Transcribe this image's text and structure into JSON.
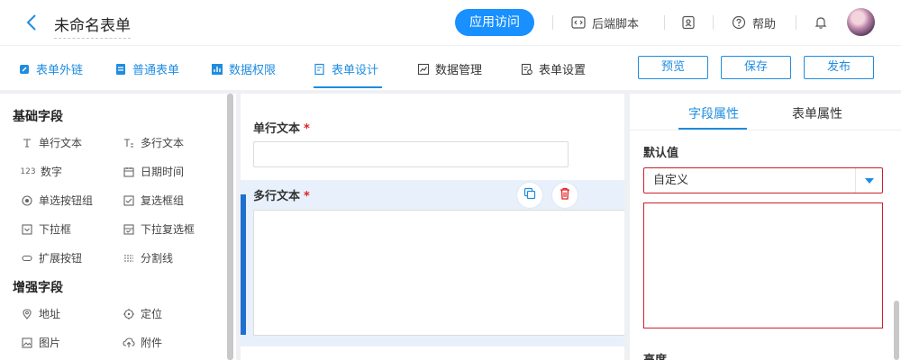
{
  "header": {
    "title": "未命名表单",
    "visit_button": "应用访问",
    "backend_script": "后端脚本",
    "help": "帮助"
  },
  "tabs": [
    {
      "label": "表单外链",
      "icon": "link-icon"
    },
    {
      "label": "普通表单",
      "icon": "form-icon"
    },
    {
      "label": "数据权限",
      "icon": "bar-chart-icon"
    },
    {
      "label": "表单设计",
      "icon": "edit-icon",
      "active": true
    },
    {
      "label": "数据管理",
      "icon": "line-chart-icon"
    },
    {
      "label": "表单设置",
      "icon": "settings-doc-icon"
    }
  ],
  "actions": {
    "preview": "预览",
    "save": "保存",
    "publish": "发布"
  },
  "fields": {
    "basic_title": "基础字段",
    "basic": [
      {
        "label": "单行文本",
        "icon": "single-line-text-icon"
      },
      {
        "label": "多行文本",
        "icon": "multi-line-text-icon"
      },
      {
        "label": "数字",
        "icon": "number-icon",
        "glyph": "123"
      },
      {
        "label": "日期时间",
        "icon": "calendar-icon"
      },
      {
        "label": "单选按钮组",
        "icon": "radio-icon"
      },
      {
        "label": "复选框组",
        "icon": "checkbox-icon"
      },
      {
        "label": "下拉框",
        "icon": "dropdown-icon"
      },
      {
        "label": "下拉复选框",
        "icon": "dropdown-multi-icon"
      },
      {
        "label": "扩展按钮",
        "icon": "extend-button-icon"
      },
      {
        "label": "分割线",
        "icon": "divider-icon"
      }
    ],
    "enhanced_title": "增强字段",
    "enhanced": [
      {
        "label": "地址",
        "icon": "location-pin-icon"
      },
      {
        "label": "定位",
        "icon": "target-icon"
      },
      {
        "label": "图片",
        "icon": "image-icon"
      },
      {
        "label": "附件",
        "icon": "cloud-upload-icon"
      }
    ]
  },
  "canvas": {
    "field1_label": "单行文本",
    "field2_label": "多行文本",
    "required_mark": "*"
  },
  "properties": {
    "tab_field": "字段属性",
    "tab_form": "表单属性",
    "default_label": "默认值",
    "default_select": "自定义",
    "height_label": "高度"
  },
  "colors": {
    "accent": "#1890ff",
    "selected_bar": "#1f6fcf",
    "error_border": "#c9202a",
    "delete_red": "#e02020"
  }
}
